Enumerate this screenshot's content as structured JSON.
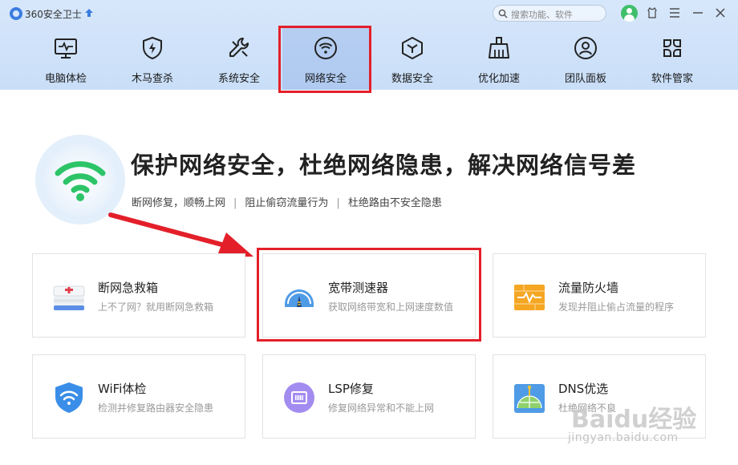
{
  "app": {
    "title": "360安全卫士"
  },
  "search": {
    "placeholder": "搜索功能、软件"
  },
  "nav": {
    "items": [
      {
        "label": "电脑体检",
        "icon": "monitor-icon"
      },
      {
        "label": "木马查杀",
        "icon": "shield-bolt-icon"
      },
      {
        "label": "系统安全",
        "icon": "wrench-icon"
      },
      {
        "label": "网络安全",
        "icon": "wifi-icon",
        "active": true
      },
      {
        "label": "数据安全",
        "icon": "cube-icon"
      },
      {
        "label": "优化加速",
        "icon": "broom-icon"
      },
      {
        "label": "团队面板",
        "icon": "team-icon"
      },
      {
        "label": "软件管家",
        "icon": "apps-icon"
      }
    ]
  },
  "hero": {
    "title": "保护网络安全，杜绝网络隐患，解决网络信号差",
    "sub": [
      "断网修复，顺畅上网",
      "阻止偷窃流量行为",
      "杜绝路由不安全隐患"
    ],
    "separator": "|"
  },
  "tools": [
    {
      "name": "断网急救箱",
      "desc": "上不了网？就用断网急救箱",
      "icon": "first-aid-icon"
    },
    {
      "name": "宽带测速器",
      "desc": "获取网络带宽和上网速度数值",
      "icon": "speedometer-icon"
    },
    {
      "name": "流量防火墙",
      "desc": "发现并阻止偷占流量的程序",
      "icon": "firewall-icon"
    },
    {
      "name": "WiFi体检",
      "desc": "检测并修复路由器安全隐患",
      "icon": "wifi-shield-icon"
    },
    {
      "name": "LSP修复",
      "desc": "修复网络异常和不能上网",
      "icon": "lsp-icon"
    },
    {
      "name": "DNS优选",
      "desc": "杜绝网络不良",
      "icon": "dns-globe-icon"
    }
  ],
  "watermark": {
    "brand": "Baidu经验",
    "url": "jingyan.baidu.com"
  },
  "colors": {
    "highlight": "#e3202a",
    "header_bg": "#cfe2f9",
    "wifi_green": "#2cc467"
  }
}
